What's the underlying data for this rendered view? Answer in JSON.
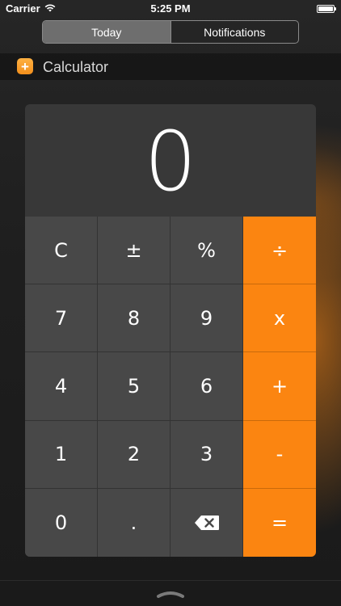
{
  "status_bar": {
    "carrier": "Carrier",
    "time": "5:25 PM",
    "wifi_icon": "wifi-icon",
    "battery_icon": "battery-icon"
  },
  "tabs": [
    {
      "label": "Today",
      "active": true
    },
    {
      "label": "Notifications",
      "active": false
    }
  ],
  "widget": {
    "icon": "plus-icon",
    "icon_glyph": "+",
    "title": "Calculator"
  },
  "calculator": {
    "display": "0",
    "keys": [
      {
        "label": "C",
        "name": "clear"
      },
      {
        "label": "±",
        "name": "plus-minus"
      },
      {
        "label": "%",
        "name": "percent"
      },
      {
        "label": "÷",
        "name": "divide"
      },
      {
        "label": "7",
        "name": "7"
      },
      {
        "label": "8",
        "name": "8"
      },
      {
        "label": "9",
        "name": "9"
      },
      {
        "label": "x",
        "name": "multiply"
      },
      {
        "label": "4",
        "name": "4"
      },
      {
        "label": "5",
        "name": "5"
      },
      {
        "label": "6",
        "name": "6"
      },
      {
        "label": "+",
        "name": "add"
      },
      {
        "label": "1",
        "name": "1"
      },
      {
        "label": "2",
        "name": "2"
      },
      {
        "label": "3",
        "name": "3"
      },
      {
        "label": "-",
        "name": "subtract"
      },
      {
        "label": "0",
        "name": "0"
      },
      {
        "label": ".",
        "name": "decimal"
      },
      {
        "label": "",
        "name": "backspace",
        "icon": "backspace-icon"
      },
      {
        "label": "=",
        "name": "equals"
      }
    ]
  },
  "colors": {
    "accent": "#fb8511",
    "key": "#484848",
    "display": "#3a3a3a"
  }
}
